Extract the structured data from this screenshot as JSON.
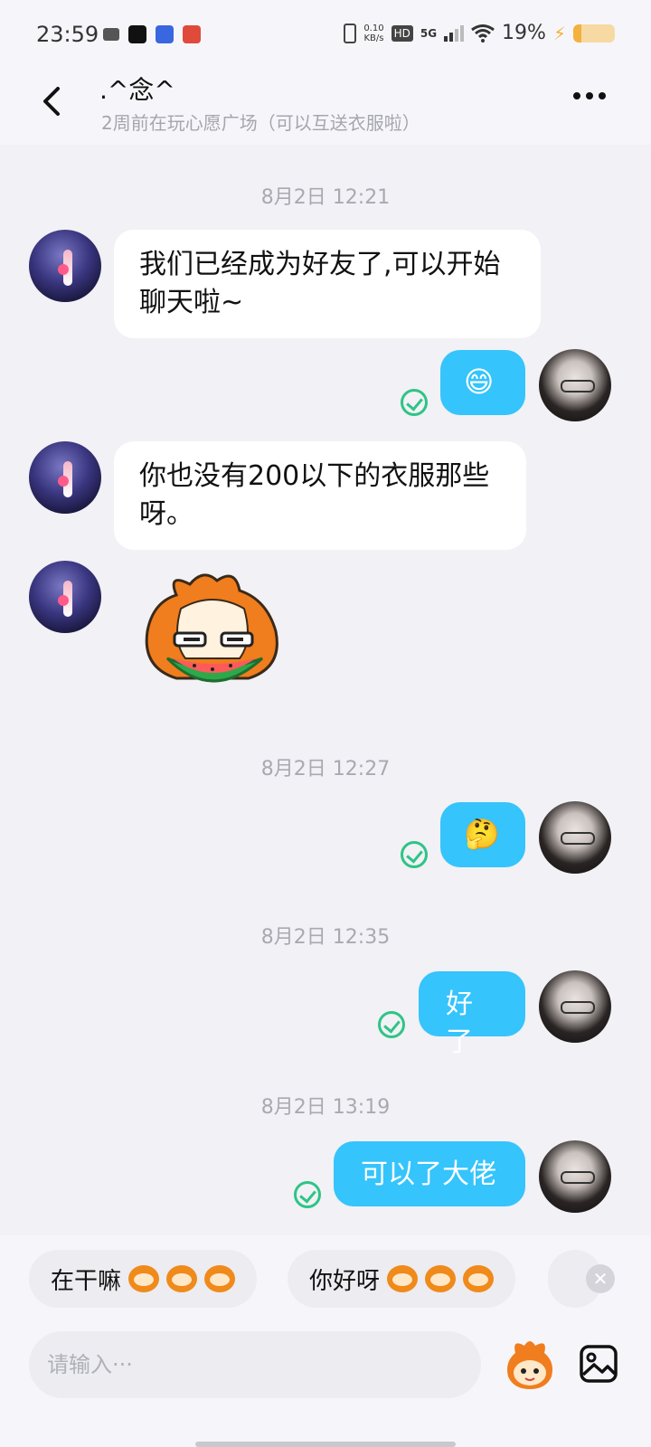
{
  "status_bar": {
    "time": "23:59",
    "net_speed_value": "0.10",
    "net_speed_unit": "KB/s",
    "hd_badge": "HD",
    "network": "5G",
    "battery_pct": "19%",
    "battery_level": 0.19,
    "icons": [
      "video-camera-icon",
      "tiktok-icon",
      "app-icon",
      "app-icon",
      "vibrate-icon",
      "signal-icon",
      "wifi-icon",
      "charging-icon",
      "battery-icon"
    ]
  },
  "header": {
    "title": ".^念^",
    "subtitle": "2周前在玩心愿广场（可以互送衣服啦）"
  },
  "messages": {
    "ts1": "8月2日 12:21",
    "m1": "我们已经成为好友了,可以开始聊天啦~",
    "m2_emoji": "😄",
    "m3": "你也没有200以下的衣服那些呀。",
    "ts2": "8月2日 12:27",
    "m5_emoji": "🤔",
    "ts3": "8月2日 12:35",
    "m6": "好了",
    "ts4": "8月2日 13:19",
    "m7": "可以了大佬"
  },
  "quick_replies": {
    "chip1": "在干嘛",
    "chip2": "你好呀"
  },
  "input": {
    "placeholder": "请输入···"
  },
  "colors": {
    "outgoing_bubble": "#35c4fb",
    "read_tick": "#2ec486",
    "background": "#f1f1f6"
  }
}
